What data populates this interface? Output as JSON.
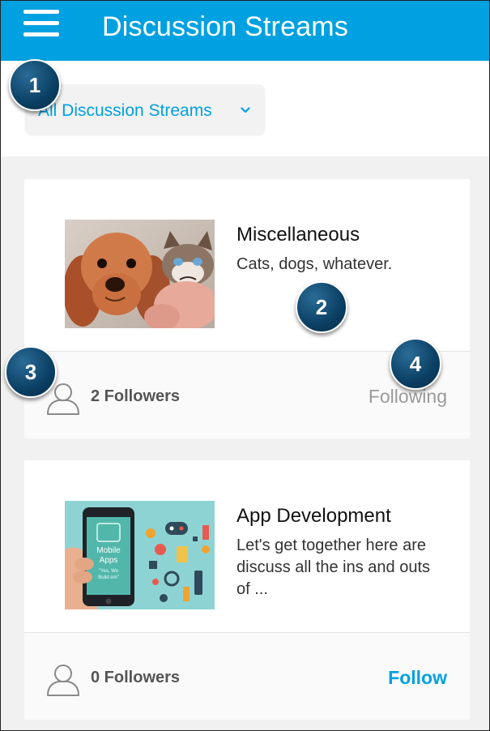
{
  "header": {
    "title": "Discussion Streams",
    "menu_icon": "hamburger-menu-icon"
  },
  "filter": {
    "label": "All Discussion Streams",
    "chevron_icon": "chevron-down-icon"
  },
  "streams": [
    {
      "title": "Miscellaneous",
      "description": "Cats, dogs, whatever.",
      "followers": "2 Followers",
      "action": "Following",
      "image": "dog-and-cat-photo"
    },
    {
      "title": "App Development",
      "description": "Let's get together here are discuss all the ins and outs of ...",
      "followers": "0 Followers",
      "action": "Follow",
      "image": "mobile-apps-illustration",
      "image_text": {
        "line1": "Mobile",
        "line2": "Apps",
        "line3": "\"Yes, We",
        "line4": "Build em\""
      }
    }
  ],
  "callouts": [
    "1",
    "2",
    "3",
    "4"
  ],
  "colors": {
    "brand": "#00a1e0",
    "callout": "#0b3f63",
    "following": "#9a9a9a"
  }
}
